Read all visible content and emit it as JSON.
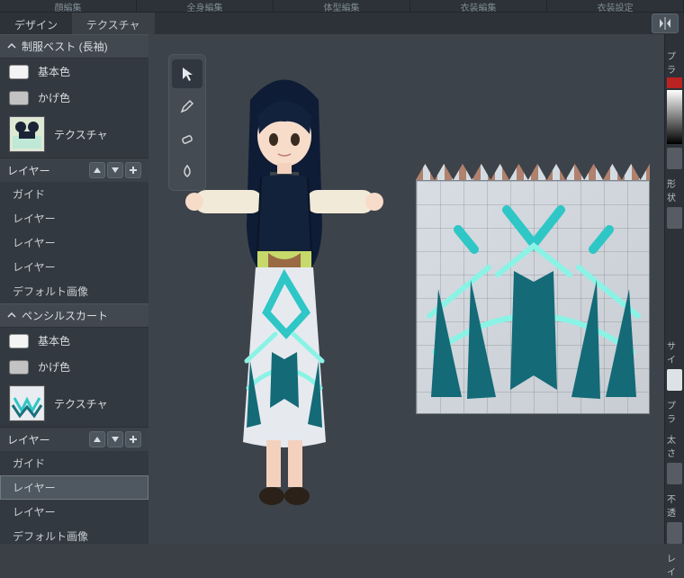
{
  "top_menu": [
    "顔編集",
    "全身編集",
    "体型編集",
    "衣装編集",
    "衣装設定"
  ],
  "tabs": {
    "design": "デザイン",
    "texture": "テクスチャ"
  },
  "sections": [
    {
      "title": "制服ベスト (長袖)",
      "base_color_label": "基本色",
      "shade_color_label": "かげ色",
      "texture_label": "テクスチャ",
      "layers_label": "レイヤー",
      "layers": [
        "ガイド",
        "レイヤー",
        "レイヤー",
        "レイヤー",
        "デフォルト画像"
      ],
      "selected_layer_index": -1
    },
    {
      "title": "ペンシルスカート",
      "base_color_label": "基本色",
      "shade_color_label": "かげ色",
      "texture_label": "テクスチャ",
      "layers_label": "レイヤー",
      "layers": [
        "ガイド",
        "レイヤー",
        "レイヤー",
        "デフォルト画像"
      ],
      "selected_layer_index": 1
    }
  ],
  "viewport_tools": {
    "select": "select",
    "pencil": "pencil",
    "eraser": "eraser",
    "drop": "drop"
  },
  "colors": {
    "accent_teal": "#2fc6c6",
    "accent_cyan": "#7ef5e5",
    "navy": "#162235",
    "skirt": "#e6eaef"
  },
  "right_panel": {
    "header": "プラ",
    "labels": [
      "形状",
      "サイ",
      "プラ",
      "太さ",
      "不透",
      "レイ"
    ]
  }
}
